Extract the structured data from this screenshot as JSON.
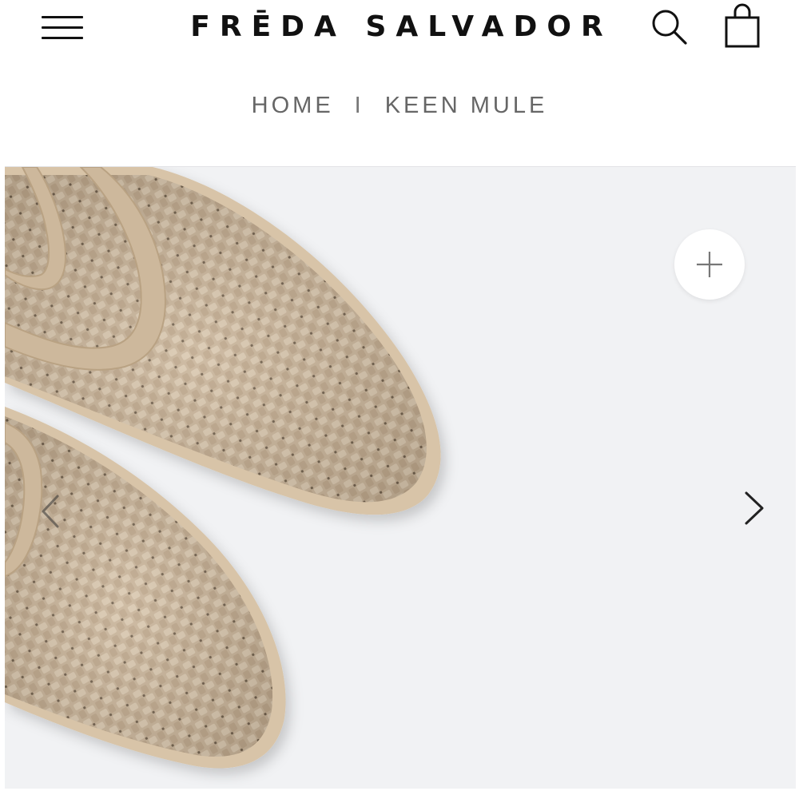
{
  "header": {
    "brand": "FRĒDA SALVADOR",
    "icons": {
      "menu": "hamburger-menu-icon",
      "search": "search-icon",
      "bag": "shopping-bag-icon"
    }
  },
  "breadcrumb": {
    "home": "HOME",
    "separator": "I",
    "current": "KEEN MULE"
  },
  "gallery": {
    "icons": {
      "zoom": "plus-icon",
      "prev": "chevron-left-icon",
      "next": "chevron-right-icon"
    }
  },
  "colors": {
    "text": "#111111",
    "breadcrumb": "#666666",
    "gallery_bg": "#f1f2f4",
    "shoe": "#c9b49a"
  }
}
